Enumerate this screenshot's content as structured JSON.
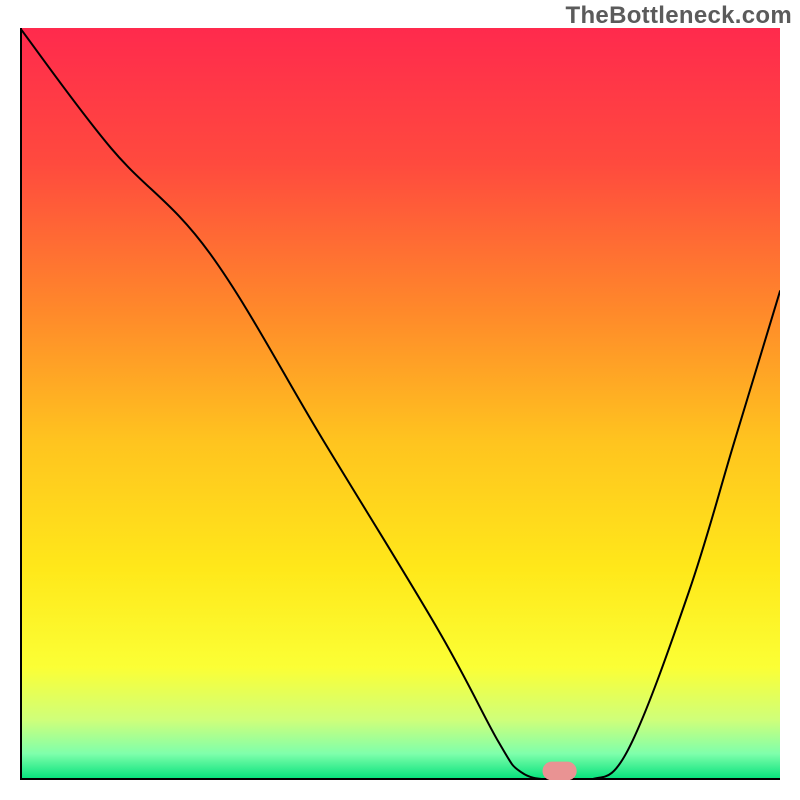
{
  "watermark": "TheBottleneck.com",
  "chart_data": {
    "type": "line",
    "title": "",
    "xlabel": "",
    "ylabel": "",
    "xlim": [
      0,
      100
    ],
    "ylim": [
      0,
      100
    ],
    "grid": false,
    "legend": false,
    "background_gradient": {
      "stops": [
        {
          "offset": 0.0,
          "color": "#ff2a4d"
        },
        {
          "offset": 0.18,
          "color": "#ff4a3e"
        },
        {
          "offset": 0.38,
          "color": "#ff8a2a"
        },
        {
          "offset": 0.55,
          "color": "#ffc41f"
        },
        {
          "offset": 0.72,
          "color": "#ffe81a"
        },
        {
          "offset": 0.85,
          "color": "#fbff35"
        },
        {
          "offset": 0.92,
          "color": "#cfff7a"
        },
        {
          "offset": 0.965,
          "color": "#7fffab"
        },
        {
          "offset": 1.0,
          "color": "#00e07a"
        }
      ]
    },
    "series": [
      {
        "name": "bottleneck-curve",
        "stroke": "#000000",
        "stroke_width": 2,
        "x": [
          0,
          12,
          25,
          40,
          55,
          63,
          66,
          70,
          75,
          80,
          88,
          94,
          100
        ],
        "values": [
          100,
          84,
          70,
          45,
          20,
          5,
          1,
          0,
          0,
          4,
          25,
          45,
          65
        ]
      }
    ],
    "marker": {
      "name": "optimal-point",
      "x": 71,
      "y": 1.2,
      "width": 4.5,
      "height": 2.5,
      "color": "#e99393",
      "corner_radius": 1.25
    }
  }
}
